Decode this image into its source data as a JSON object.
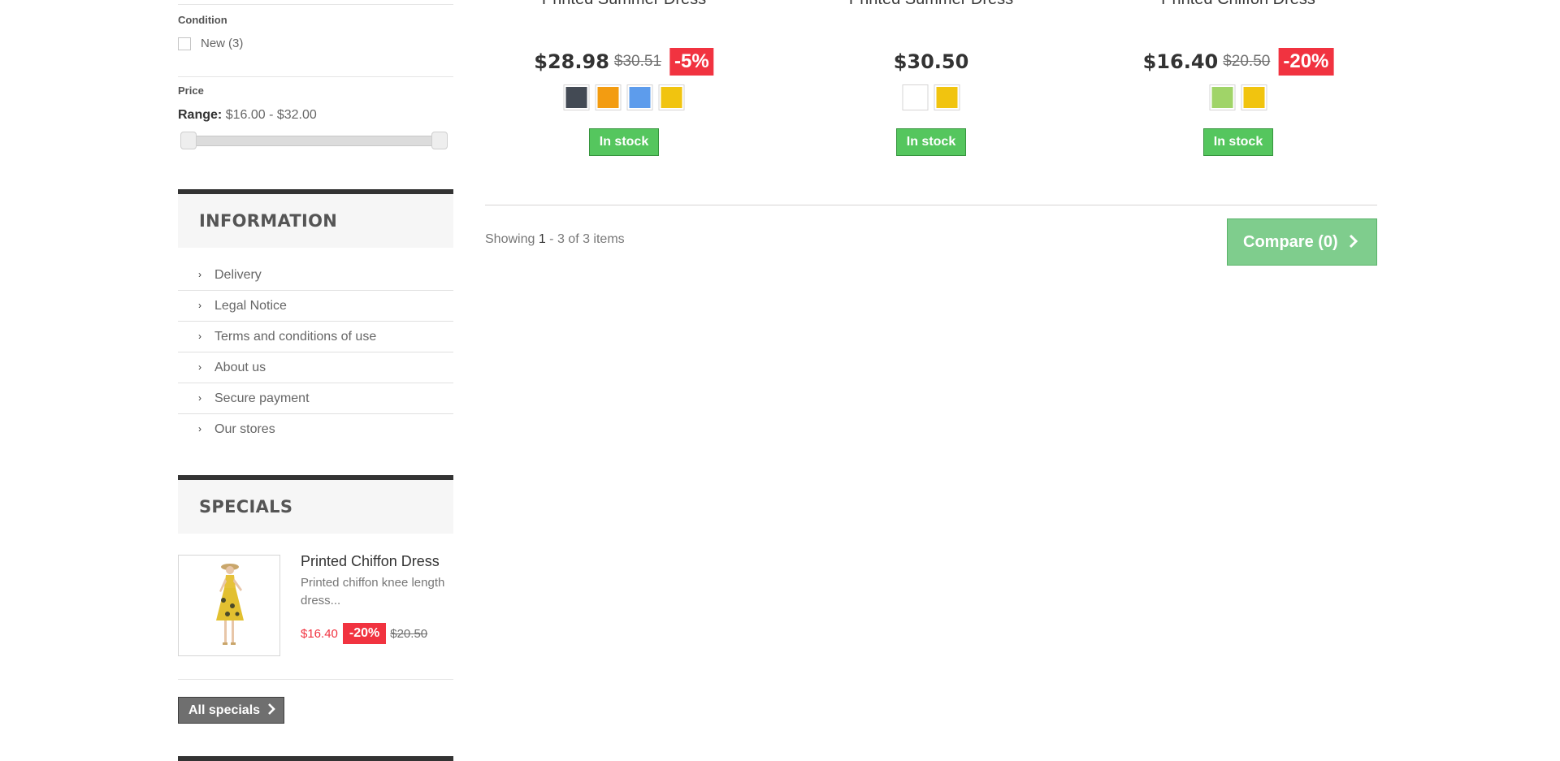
{
  "filters": {
    "condition": {
      "title": "Condition",
      "option_label": "New",
      "option_count": "(3)"
    },
    "price": {
      "title": "Price",
      "range_label": "Range:",
      "range_value": "$16.00 - $32.00"
    }
  },
  "information": {
    "title": "INFORMATION",
    "chevron": "›",
    "items": [
      {
        "label": "Delivery"
      },
      {
        "label": "Legal Notice"
      },
      {
        "label": "Terms and conditions of use"
      },
      {
        "label": "About us"
      },
      {
        "label": "Secure payment"
      },
      {
        "label": "Our stores"
      }
    ]
  },
  "specials": {
    "title": "SPECIALS",
    "product": {
      "name": "Printed Chiffon Dress",
      "description": "Printed chiffon knee length dress...",
      "price": "$16.40",
      "discount": "-20%",
      "old_price": "$20.50"
    },
    "button_label": "All specials",
    "button_icon": "chevron-right-icon"
  },
  "products": [
    {
      "name": "Printed Summer Dress",
      "price": "$28.98",
      "old_price": "$30.51",
      "discount": "-5%",
      "colors": [
        "#434a54",
        "#f39c11",
        "#5d9cec",
        "#f1c40f"
      ],
      "stock": "In stock"
    },
    {
      "name": "Printed Summer Dress",
      "price": "$30.50",
      "old_price": "",
      "discount": "",
      "colors": [
        "#ffffff",
        "#f1c40f"
      ],
      "stock": "In stock"
    },
    {
      "name": "Printed Chiffon Dress",
      "price": "$16.40",
      "old_price": "$20.50",
      "discount": "-20%",
      "colors": [
        "#a0d468",
        "#f1c40f"
      ],
      "stock": "In stock"
    }
  ],
  "pagination": {
    "showing_prefix": "Showing ",
    "range_start": "1",
    "range_rest": " - 3 of 3 items"
  },
  "compare": {
    "label": "Compare (0)",
    "icon": "chevron-right-icon"
  },
  "colors": {
    "stock_green": "#55c65e",
    "discount_red": "#f13340",
    "compare_green": "#7fcd8d",
    "specials_price_red": "#f13340"
  }
}
